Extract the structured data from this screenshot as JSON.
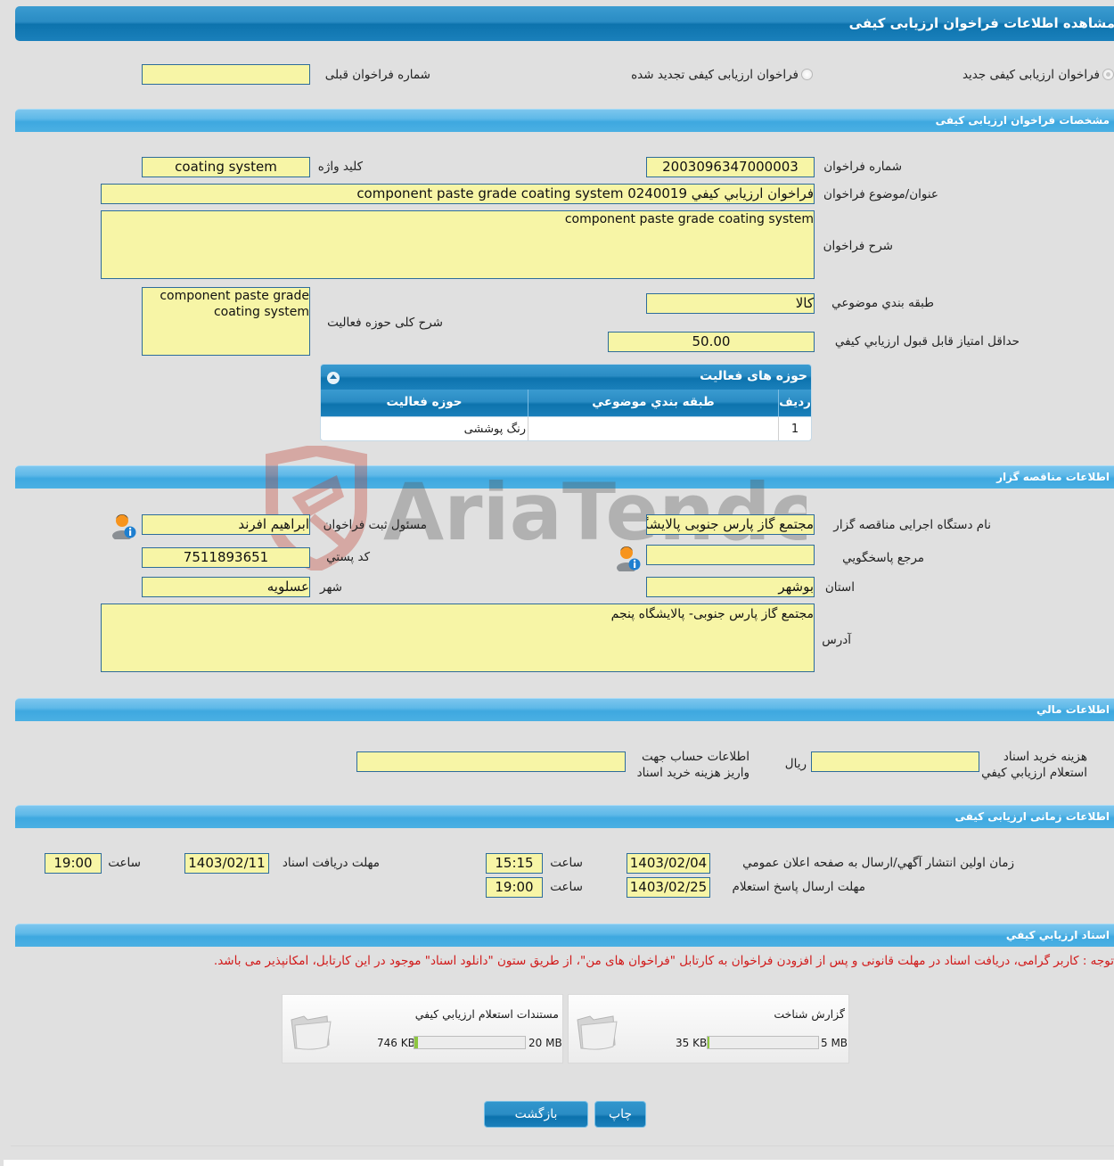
{
  "page_title": "مشاهده اطلاعات فراخوان ارزیابی کیفی",
  "call_type": {
    "options": [
      {
        "label": "فراخوان ارزیابی کیفی جدید",
        "selected": true
      },
      {
        "label": "فراخوان ارزیابی کیفی تجدید شده",
        "selected": false
      }
    ],
    "previous_call_label": "شماره فراخوان قبلی",
    "previous_call_value": ""
  },
  "sections": {
    "specs": "مشخصات فراخوان ارزیابی کیفی",
    "organizer": "اطلاعات مناقصه گزار",
    "financial": "اطلاعات مالي",
    "timing": "اطلاعات زمانی ارزیابی کیفی",
    "documents": "اسناد ارزیابي کیفي"
  },
  "specs": {
    "call_number_label": "شماره فراخوان",
    "call_number": "2003096347000003",
    "keyword_label": "كليد واژه",
    "keyword": "coating system",
    "title_label": "عنوان/موضوع فراخوان",
    "title": "فراخوان ارزيابي كيفي 0240019 component paste grade coating system",
    "description_label": "شرح فراخوان",
    "description": "component paste grade coating system",
    "category_label": "طبقه بندي موضوعي",
    "category": "کالا",
    "activity_desc_label": "شرح کلی حوزه فعالیت",
    "activity_desc": "component paste grade coating system",
    "min_score_label": "حداقل امتياز قابل قبول ارزيابي كيفي",
    "min_score": "50.00"
  },
  "activity_grid": {
    "caption": "حوزه های فعالیت",
    "columns": [
      "رديف",
      "طبقه بندي موضوعي",
      "حوزه فعالیت"
    ],
    "rows": [
      {
        "index": "1",
        "category": "",
        "activity": "رنگ پوششی"
      }
    ]
  },
  "organizer": {
    "org_name_label": "نام دستگاه اجرایی مناقصه گزار",
    "org_name": "مجتمع گاز پارس جنوبی  پالایشگاه پنجم",
    "registrar_label": "مسئول ثبت فراخوان",
    "registrar": "ابراهیم افرند",
    "reference_label": "مرجع پاسخگويي",
    "reference": "",
    "postal_label": "کد پستي",
    "postal": "7511893651",
    "province_label": "استان",
    "province": "بوشهر",
    "city_label": "شهر",
    "city": "عسلویه",
    "address_label": "آدرس",
    "address": "مجتمع گاز پارس جنوبی- پالایشگاه پنجم"
  },
  "financial": {
    "fee_label_1": "هزینه خرید اسناد",
    "fee_label_2": "استعلام ارزيابي كيفي",
    "fee_value": "",
    "currency": "ريال",
    "account_label_1": "اطلاعات حساب جهت",
    "account_label_2": "واریز هزینه خرید اسناد",
    "account_value": ""
  },
  "timing": {
    "publish_label": "زمان اولين انتشار آگهي/ارسال به صفحه اعلان عمومي",
    "publish_date": "1403/02/04",
    "publish_time": "15:15",
    "time_label": "ساعت",
    "doc_deadline_label": "مهلت دریافت اسناد",
    "doc_deadline_date": "1403/02/11",
    "doc_deadline_time": "19:00",
    "response_label": "مهلت ارسال پاسخ استعلام",
    "response_date": "1403/02/25",
    "response_time": "19:00"
  },
  "documents": {
    "notice": "توجه : کاربر گرامی، دریافت اسناد در مهلت قانونی و پس از افزودن فراخوان به کارتابل \"فراخوان های من\"، از طریق ستون \"دانلود اسناد\" موجود در این کارتابل، امکانپذیر می باشد.",
    "items": [
      {
        "title": "گزارش شناخت",
        "size": "35 KB",
        "max": "5 MB",
        "fill_fraction": 0.007
      },
      {
        "title": "مستندات استعلام ارزيابي كيفي",
        "size": "746 KB",
        "max": "20 MB",
        "fill_fraction": 0.036
      }
    ]
  },
  "buttons": {
    "print": "چاپ",
    "back": "بازگشت"
  },
  "watermark": "AriaTender.neT"
}
